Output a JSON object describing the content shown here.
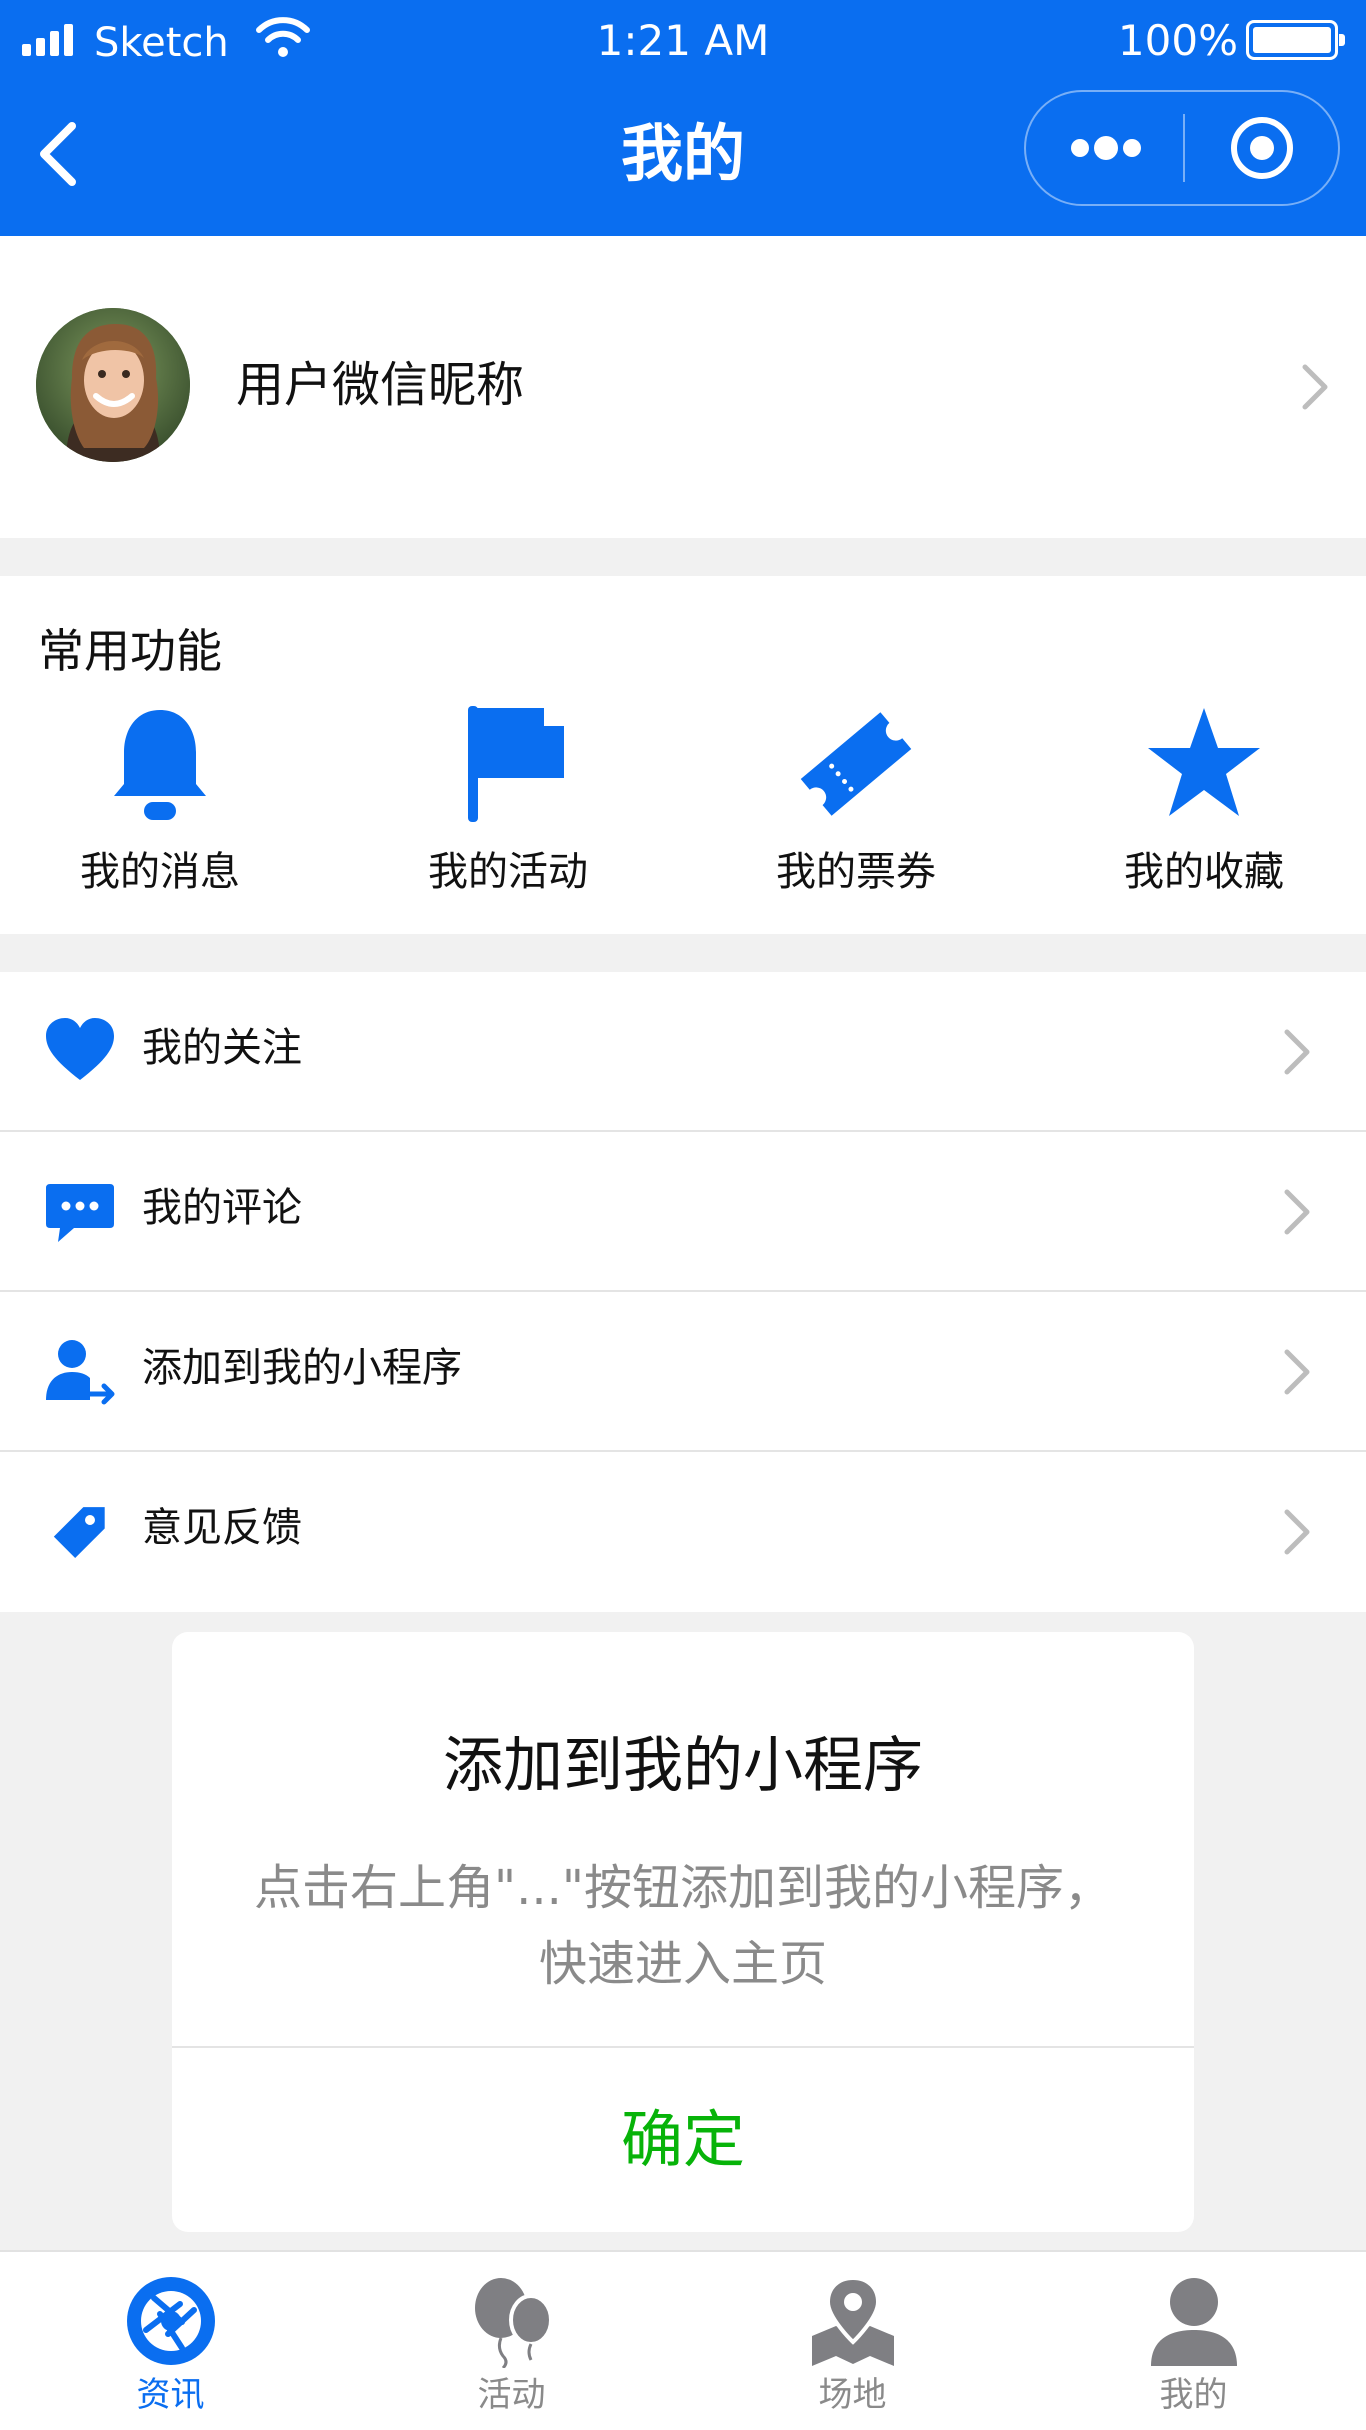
{
  "status_bar": {
    "carrier": "Sketch",
    "time": "1:21 AM",
    "battery": "100%"
  },
  "nav": {
    "title": "我的",
    "back_icon": "chevron-left-icon",
    "more_icon": "more-dots-icon",
    "close_icon": "target-circle-icon"
  },
  "profile": {
    "nickname": "用户微信昵称"
  },
  "common": {
    "title": "常用功能",
    "items": [
      {
        "label": "我的消息",
        "icon": "bell-icon"
      },
      {
        "label": "我的活动",
        "icon": "flag-icon"
      },
      {
        "label": "我的票券",
        "icon": "ticket-icon"
      },
      {
        "label": "我的收藏",
        "icon": "star-icon"
      }
    ]
  },
  "list": [
    {
      "label": "我的关注",
      "icon": "heart-icon"
    },
    {
      "label": "我的评论",
      "icon": "chat-icon"
    },
    {
      "label": "添加到我的小程序",
      "icon": "user-share-icon"
    },
    {
      "label": "意见反馈",
      "icon": "tag-icon"
    }
  ],
  "modal": {
    "title": "添加到我的小程序",
    "body": "点击右上角\"...\"按钮添加到我的小程序，快速进入主页",
    "confirm": "确定"
  },
  "tabs": [
    {
      "label": "资讯",
      "icon": "aperture-icon",
      "active": true
    },
    {
      "label": "活动",
      "icon": "balloons-icon",
      "active": false
    },
    {
      "label": "场地",
      "icon": "map-pin-icon",
      "active": false
    },
    {
      "label": "我的",
      "icon": "person-icon",
      "active": false
    }
  ],
  "colors": {
    "brand": "#0a6ef0",
    "confirm": "#07b309",
    "muted": "#8a8a8a",
    "tab_inactive": "#7f7f83"
  }
}
